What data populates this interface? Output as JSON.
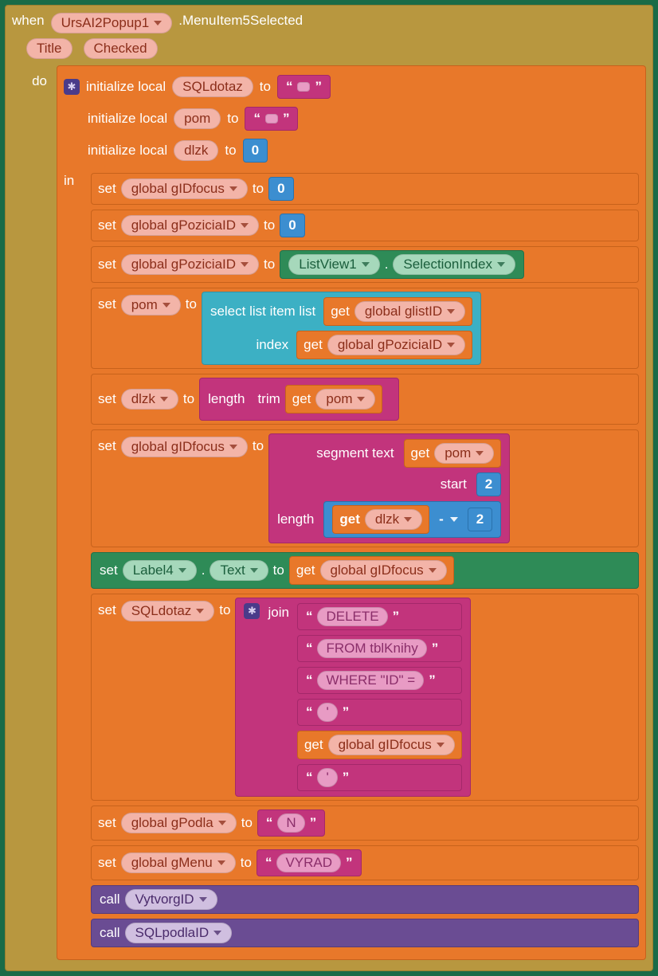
{
  "header": {
    "when": "when",
    "component": "UrsAI2Popup1",
    "event": ".MenuItem5Selected",
    "param_title": "Title",
    "param_checked": "Checked"
  },
  "do": "do",
  "in": "in",
  "init": {
    "label": "initialize local",
    "to": "to",
    "vars": [
      "SQLdotaz",
      "pom",
      "dlzk"
    ],
    "vals_text": [
      "",
      ""
    ],
    "vals_num": "0"
  },
  "sets": {
    "set": "set",
    "to": "to",
    "gIDfocus": "global gIDfocus",
    "gPoziciaID": "global gPoziciaID",
    "gPodla": "global gPodla",
    "gMenu": "global gMenu",
    "pom": "pom",
    "dlzk": "dlzk",
    "SQLdotaz": "SQLdotaz",
    "zero": "0",
    "listview": "ListView1",
    "dot": ".",
    "selidx": "SelectionIndex"
  },
  "listops": {
    "selectlist": "select list item  list",
    "index": "index",
    "get": "get",
    "glistID": "global glistID"
  },
  "textops": {
    "length": "length",
    "trim": "trim",
    "segment": "segment  text",
    "start": "start",
    "len": "length",
    "two": "2",
    "minus": "-"
  },
  "label4": {
    "comp": "Label4",
    "prop": "Text"
  },
  "join": {
    "join": "join",
    "delete": "DELETE ",
    "from": " FROM tblKnihy ",
    "where": " WHERE \"ID\"  = ",
    "q1": "'",
    "q2": "'"
  },
  "consts": {
    "N": "N",
    "VYRAD": "VYRAD"
  },
  "calls": {
    "call": "call",
    "proc1": "VytvorgID",
    "proc2": "SQLpodlaID"
  }
}
